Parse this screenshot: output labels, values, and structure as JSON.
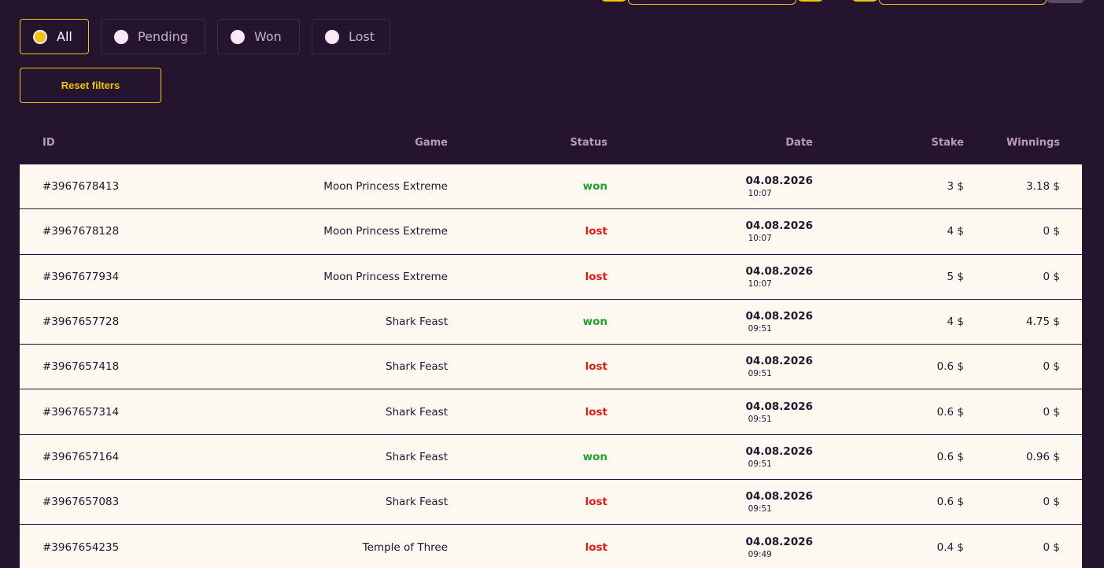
{
  "filters": {
    "options": [
      {
        "label": "All",
        "active": true
      },
      {
        "label": "Pending",
        "active": false
      },
      {
        "label": "Won",
        "active": false
      },
      {
        "label": "Lost",
        "active": false
      }
    ],
    "reset_label": "Reset filters"
  },
  "table": {
    "headers": {
      "id": "ID",
      "game": "Game",
      "status": "Status",
      "date": "Date",
      "stake": "Stake",
      "winnings": "Winnings"
    },
    "rows": [
      {
        "id": "#3967678413",
        "game": "Moon Princess Extreme",
        "status": "won",
        "date": "04.08.2026",
        "time": "10:07",
        "stake": "3 $",
        "winnings": "3.18 $"
      },
      {
        "id": "#3967678128",
        "game": "Moon Princess Extreme",
        "status": "lost",
        "date": "04.08.2026",
        "time": "10:07",
        "stake": "4 $",
        "winnings": "0 $"
      },
      {
        "id": "#3967677934",
        "game": "Moon Princess Extreme",
        "status": "lost",
        "date": "04.08.2026",
        "time": "10:07",
        "stake": "5 $",
        "winnings": "0 $"
      },
      {
        "id": "#3967657728",
        "game": "Shark Feast",
        "status": "won",
        "date": "04.08.2026",
        "time": "09:51",
        "stake": "4 $",
        "winnings": "4.75 $"
      },
      {
        "id": "#3967657418",
        "game": "Shark Feast",
        "status": "lost",
        "date": "04.08.2026",
        "time": "09:51",
        "stake": "0.6 $",
        "winnings": "0 $"
      },
      {
        "id": "#3967657314",
        "game": "Shark Feast",
        "status": "lost",
        "date": "04.08.2026",
        "time": "09:51",
        "stake": "0.6 $",
        "winnings": "0 $"
      },
      {
        "id": "#3967657164",
        "game": "Shark Feast",
        "status": "won",
        "date": "04.08.2026",
        "time": "09:51",
        "stake": "0.6 $",
        "winnings": "0.96 $"
      },
      {
        "id": "#3967657083",
        "game": "Shark Feast",
        "status": "lost",
        "date": "04.08.2026",
        "time": "09:51",
        "stake": "0.6 $",
        "winnings": "0 $"
      },
      {
        "id": "#3967654235",
        "game": "Temple of Three",
        "status": "lost",
        "date": "04.08.2026",
        "time": "09:49",
        "stake": "0.4 $",
        "winnings": "0 $"
      }
    ]
  },
  "colors": {
    "background": "#24142e",
    "accent": "#f1c40f",
    "row_background": "#fdf8f0",
    "won": "#1fa32a",
    "lost": "#e01a1a"
  }
}
